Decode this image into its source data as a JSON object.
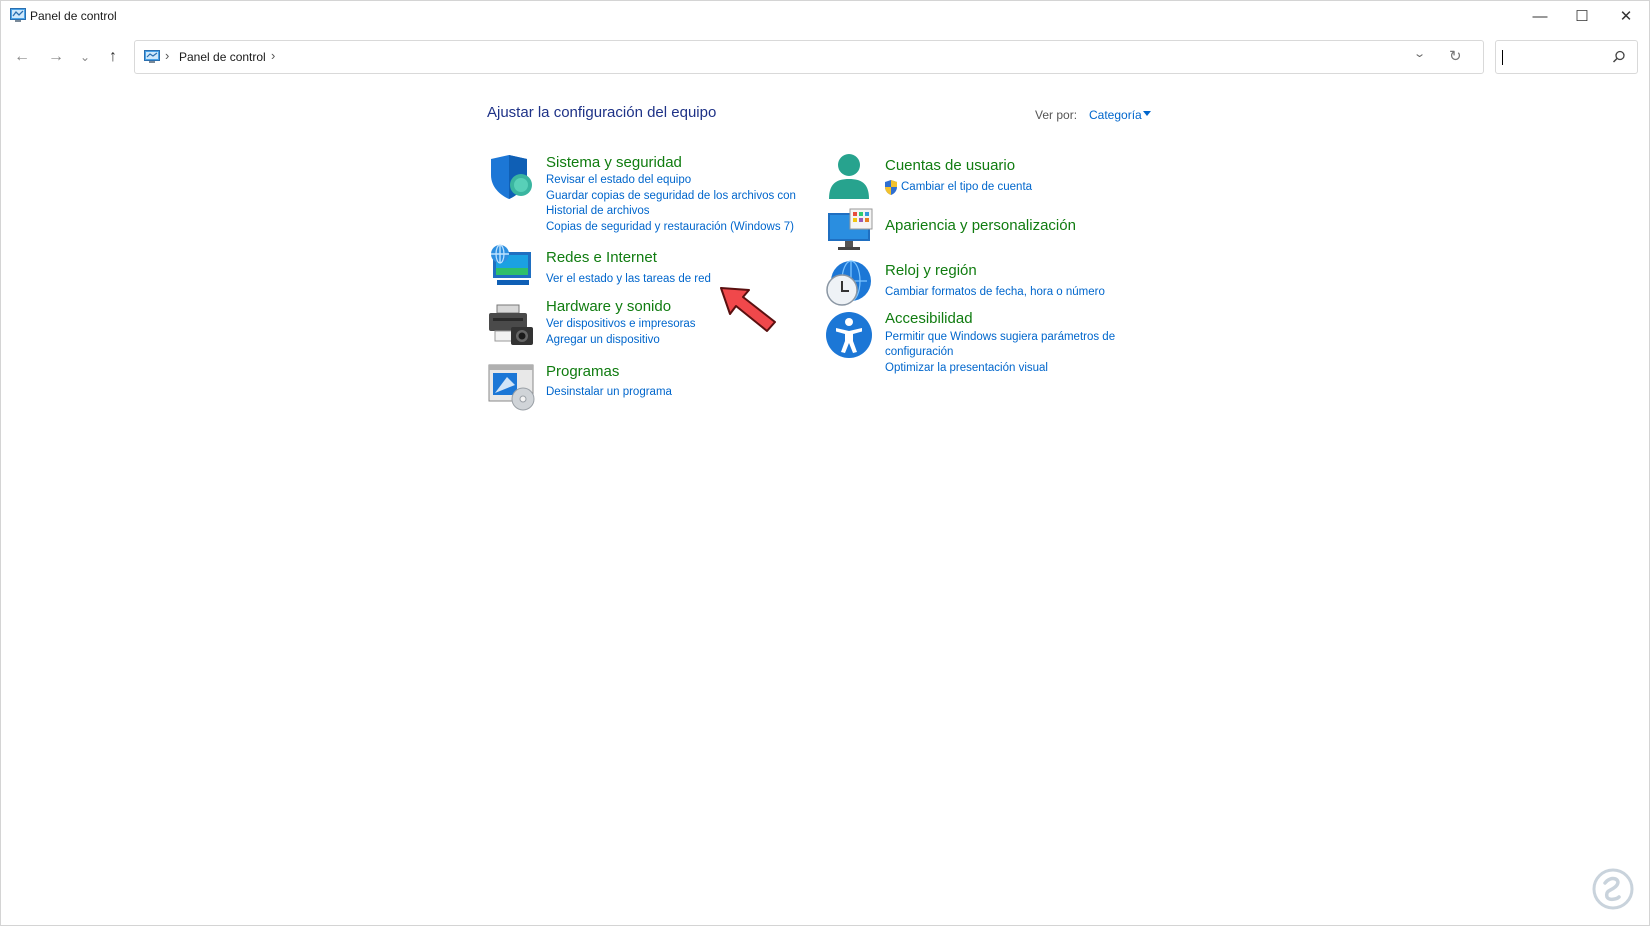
{
  "window": {
    "title": "Panel de control"
  },
  "caption": {
    "minimize": "—",
    "maximize": "☐",
    "close": "✕"
  },
  "nav": {
    "back": "←",
    "forward": "→",
    "recent": "⌄",
    "up": "↑"
  },
  "address": {
    "crumb": "Panel de control",
    "sep": "›",
    "dropdown": "⌄",
    "refresh": "↻"
  },
  "search": {
    "placeholder": "",
    "value": ""
  },
  "page": {
    "title": "Ajustar la configuración del equipo",
    "view_by_label": "Ver por:",
    "view_by_value": "Categoría"
  },
  "categories": {
    "system": {
      "icon": "security-shield-icon",
      "title": "Sistema y seguridad",
      "links": [
        "Revisar el estado del equipo",
        "Guardar copias de seguridad de los archivos con Historial de archivos",
        "Copias de seguridad y restauración (Windows 7)"
      ]
    },
    "network": {
      "icon": "network-globe-icon",
      "title": "Redes e Internet",
      "links": [
        "Ver el estado y las tareas de red"
      ]
    },
    "hardware": {
      "icon": "printer-camera-icon",
      "title": "Hardware y sonido",
      "links": [
        "Ver dispositivos e impresoras",
        "Agregar un dispositivo"
      ]
    },
    "programs": {
      "icon": "programs-disc-icon",
      "title": "Programas",
      "links": [
        "Desinstalar un programa"
      ]
    },
    "users": {
      "icon": "user-accounts-icon",
      "title": "Cuentas de usuario",
      "links": [
        "Cambiar el tipo de cuenta"
      ]
    },
    "appearance": {
      "icon": "appearance-monitor-icon",
      "title": "Apariencia y personalización",
      "links": []
    },
    "clock": {
      "icon": "clock-globe-icon",
      "title": "Reloj y región",
      "links": [
        "Cambiar formatos de fecha, hora o número"
      ]
    },
    "accessibility": {
      "icon": "accessibility-icon",
      "title": "Accesibilidad",
      "links": [
        "Permitir que Windows sugiera parámetros de configuración",
        "Optimizar la presentación visual"
      ]
    }
  },
  "colors": {
    "category_title": "#107c10",
    "link": "#0066cc",
    "page_title": "#1e3287",
    "arrow": "#f0484b"
  }
}
